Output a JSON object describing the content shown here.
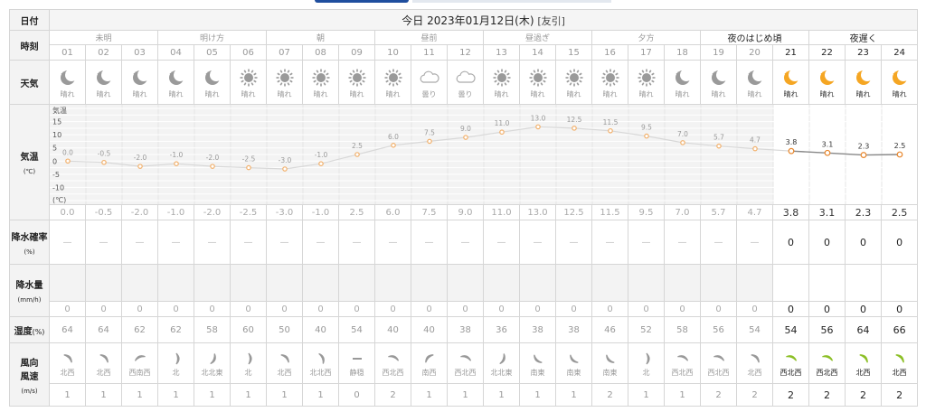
{
  "header": {
    "date_label": "日付",
    "date_text": "今日 2023年01月12日(木)",
    "rokuyo": "[友引]"
  },
  "labels": {
    "time": "時刻",
    "weather": "天気",
    "temp": "気温",
    "temp_unit": "(℃)",
    "rain_prob": "降水確率",
    "rain_prob_unit": "(%)",
    "rain_amt": "降水量",
    "rain_amt_unit": "(mm/h)",
    "humidity": "湿度",
    "humidity_unit": "(%)",
    "wind_dir": "風向",
    "wind_speed": "風速",
    "wind_unit": "(m/s)"
  },
  "periods": [
    {
      "label": "未明",
      "active": false
    },
    {
      "label": "明け方",
      "active": false
    },
    {
      "label": "朝",
      "active": false
    },
    {
      "label": "昼前",
      "active": false
    },
    {
      "label": "昼過ぎ",
      "active": false
    },
    {
      "label": "夕方",
      "active": false
    },
    {
      "label": "夜のはじめ頃",
      "active": true
    },
    {
      "label": "夜遅く",
      "active": true
    }
  ],
  "hours": [
    "01",
    "02",
    "03",
    "04",
    "05",
    "06",
    "07",
    "08",
    "09",
    "10",
    "11",
    "12",
    "13",
    "14",
    "15",
    "16",
    "17",
    "18",
    "19",
    "20",
    "21",
    "22",
    "23",
    "24"
  ],
  "first_active_index": 20,
  "weather": [
    {
      "icon": "moon-icon",
      "label": "晴れ"
    },
    {
      "icon": "moon-icon",
      "label": "晴れ"
    },
    {
      "icon": "moon-icon",
      "label": "晴れ"
    },
    {
      "icon": "moon-icon",
      "label": "晴れ"
    },
    {
      "icon": "moon-icon",
      "label": "晴れ"
    },
    {
      "icon": "sun-icon",
      "label": "晴れ"
    },
    {
      "icon": "sun-icon",
      "label": "晴れ"
    },
    {
      "icon": "sun-icon",
      "label": "晴れ"
    },
    {
      "icon": "sun-icon",
      "label": "晴れ"
    },
    {
      "icon": "sun-icon",
      "label": "晴れ"
    },
    {
      "icon": "cloud-icon",
      "label": "曇り"
    },
    {
      "icon": "cloud-icon",
      "label": "曇り"
    },
    {
      "icon": "sun-icon",
      "label": "晴れ"
    },
    {
      "icon": "sun-icon",
      "label": "晴れ"
    },
    {
      "icon": "sun-icon",
      "label": "晴れ"
    },
    {
      "icon": "sun-icon",
      "label": "晴れ"
    },
    {
      "icon": "sun-icon",
      "label": "晴れ"
    },
    {
      "icon": "moon-icon",
      "label": "晴れ"
    },
    {
      "icon": "moon-icon",
      "label": "晴れ"
    },
    {
      "icon": "moon-icon",
      "label": "晴れ"
    },
    {
      "icon": "moon-icon",
      "label": "晴れ"
    },
    {
      "icon": "moon-icon",
      "label": "晴れ"
    },
    {
      "icon": "moon-icon",
      "label": "晴れ"
    },
    {
      "icon": "moon-icon",
      "label": "晴れ"
    }
  ],
  "temperatures": [
    "0.0",
    "-0.5",
    "-2.0",
    "-1.0",
    "-2.0",
    "-2.5",
    "-3.0",
    "-1.0",
    "2.5",
    "6.0",
    "7.5",
    "9.0",
    "11.0",
    "13.0",
    "12.5",
    "11.5",
    "9.5",
    "7.0",
    "5.7",
    "4.7",
    "3.8",
    "3.1",
    "2.3",
    "2.5"
  ],
  "rain_prob": [
    "—",
    "—",
    "—",
    "—",
    "—",
    "—",
    "—",
    "—",
    "—",
    "—",
    "—",
    "—",
    "—",
    "—",
    "—",
    "—",
    "—",
    "—",
    "—",
    "—",
    "0",
    "0",
    "0",
    "0"
  ],
  "rain_amt": [
    "0",
    "0",
    "0",
    "0",
    "0",
    "0",
    "0",
    "0",
    "0",
    "0",
    "0",
    "0",
    "0",
    "0",
    "0",
    "0",
    "0",
    "0",
    "0",
    "0",
    "0",
    "0",
    "0",
    "0"
  ],
  "humidity": [
    "64",
    "64",
    "62",
    "62",
    "58",
    "60",
    "50",
    "40",
    "54",
    "40",
    "40",
    "38",
    "36",
    "38",
    "38",
    "46",
    "52",
    "58",
    "56",
    "54",
    "54",
    "56",
    "64",
    "66"
  ],
  "wind_dir": [
    "北西",
    "北西",
    "西南西",
    "北",
    "北北東",
    "北",
    "北西",
    "北北西",
    "静穏",
    "西北西",
    "南西",
    "西北西",
    "北北東",
    "南東",
    "南東",
    "南東",
    "北",
    "西北西",
    "西北西",
    "北西",
    "西北西",
    "西北西",
    "北西",
    "北西"
  ],
  "wind_speed": [
    "1",
    "1",
    "1",
    "1",
    "1",
    "1",
    "1",
    "1",
    "0",
    "2",
    "1",
    "1",
    "1",
    "1",
    "1",
    "2",
    "1",
    "1",
    "2",
    "2",
    "2",
    "2",
    "2",
    "2"
  ],
  "chart_data": {
    "type": "line",
    "categories": [
      "01",
      "02",
      "03",
      "04",
      "05",
      "06",
      "07",
      "08",
      "09",
      "10",
      "11",
      "12",
      "13",
      "14",
      "15",
      "16",
      "17",
      "18",
      "19",
      "20",
      "21",
      "22",
      "23",
      "24"
    ],
    "values": [
      0.0,
      -0.5,
      -2.0,
      -1.0,
      -2.0,
      -2.5,
      -3.0,
      -1.0,
      2.5,
      6.0,
      7.5,
      9.0,
      11.0,
      13.0,
      12.5,
      11.5,
      9.5,
      7.0,
      5.7,
      4.7,
      3.8,
      3.1,
      2.3,
      2.5
    ],
    "ylabel": "気温",
    "yunit": "(℃)",
    "yticks": [
      "15",
      "10",
      "5",
      "0",
      "-5",
      "-10"
    ],
    "ylim": [
      -15,
      20
    ],
    "grid": true,
    "colors": {
      "past_line": "#d8d8d8",
      "past_dot": "#f2b06b",
      "active": "#e8862b"
    }
  }
}
